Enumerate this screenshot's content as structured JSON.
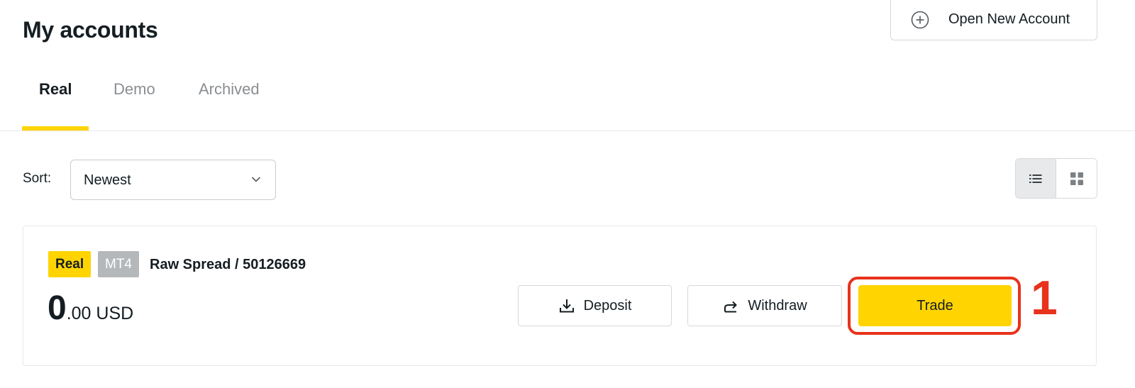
{
  "header": {
    "title": "My accounts",
    "open_account_label": "Open New Account",
    "open_account_icon": "plus-circle-icon"
  },
  "tabs": [
    {
      "label": "Real",
      "active": true
    },
    {
      "label": "Demo",
      "active": false
    },
    {
      "label": "Archived",
      "active": false
    }
  ],
  "sort": {
    "label": "Sort:",
    "selected": "Newest"
  },
  "view_toggle": {
    "options": [
      "list-view-icon",
      "grid-view-icon"
    ],
    "selected": "list"
  },
  "account": {
    "type_badge": "Real",
    "platform_badge": "MT4",
    "name": "Raw Spread / 50126669",
    "balance_int": "0",
    "balance_dec": ".00 USD",
    "actions": {
      "deposit": "Deposit",
      "withdraw": "Withdraw",
      "trade": "Trade"
    }
  },
  "annotation": {
    "number": "1",
    "color": "#e8321c"
  },
  "colors": {
    "accent": "#ffd400",
    "text": "#141d22",
    "muted": "#8a8e92",
    "annotation": "#e8321c"
  }
}
